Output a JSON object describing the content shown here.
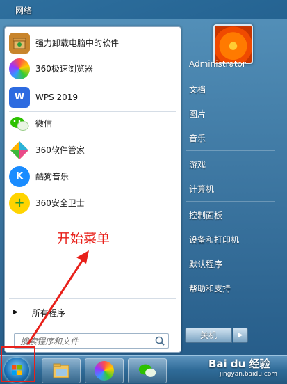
{
  "desktop": {
    "network_label": "网络"
  },
  "start_menu": {
    "programs": [
      {
        "label": "强力卸载电脑中的软件",
        "icon": "uninstall-box-icon",
        "color": "#c8852c"
      },
      {
        "label": "360极速浏览器",
        "icon": "360-browser-icon",
        "color": "#3a9be0"
      },
      {
        "label": "WPS 2019",
        "icon": "wps-icon",
        "color": "#2d6be0"
      },
      {
        "label": "微信",
        "icon": "wechat-icon",
        "color": "#2dc100"
      },
      {
        "label": "360软件管家",
        "icon": "360-software-manager-icon",
        "color": "#2bb3d8"
      },
      {
        "label": "酷狗音乐",
        "icon": "kugou-music-icon",
        "color": "#1a8cff"
      },
      {
        "label": "360安全卫士",
        "icon": "360-security-icon",
        "color": "#3cb83c"
      }
    ],
    "all_programs_label": "所有程序",
    "search_placeholder": "搜索程序和文件",
    "right_items": [
      "Administrator",
      "文档",
      "图片",
      "音乐",
      "游戏",
      "计算机",
      "控制面板",
      "设备和打印机",
      "默认程序",
      "帮助和支持"
    ],
    "shutdown_label": "关机"
  },
  "annotation": {
    "text": "开始菜单",
    "color": "#e8201a"
  },
  "watermark": {
    "brand": "Bai du 经验",
    "url": "jingyan.baidu.com"
  }
}
